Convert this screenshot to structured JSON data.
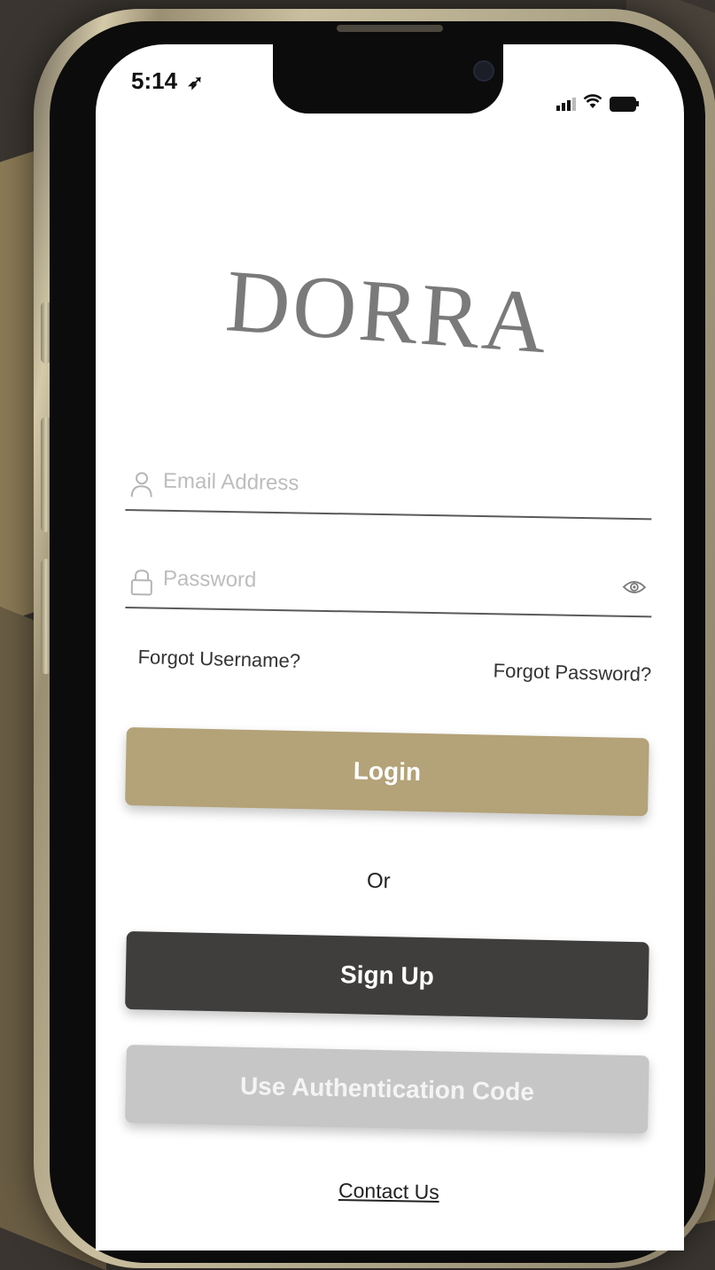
{
  "status_bar": {
    "time": "5:14",
    "location_icon": "location-arrow-icon",
    "signal_icon": "cellular-signal-icon",
    "wifi_icon": "wifi-icon",
    "battery_icon": "battery-icon"
  },
  "brand": {
    "logo_text": "DORRA"
  },
  "form": {
    "email": {
      "placeholder": "Email Address",
      "value": "",
      "icon": "user-icon"
    },
    "password": {
      "placeholder": "Password",
      "value": "",
      "icon": "lock-icon",
      "toggle_icon": "eye-icon"
    },
    "forgot_username": "Forgot Username?",
    "forgot_password": "Forgot Password?"
  },
  "actions": {
    "login_label": "Login",
    "or_label": "Or",
    "signup_label": "Sign Up",
    "auth_code_label": "Use Authentication Code",
    "contact_label": "Contact Us"
  },
  "colors": {
    "primary_gold": "#b4a278",
    "dark_button": "#3f3e3d",
    "disabled_button": "#c6c6c6",
    "logo_gray": "#7a7a7a"
  }
}
